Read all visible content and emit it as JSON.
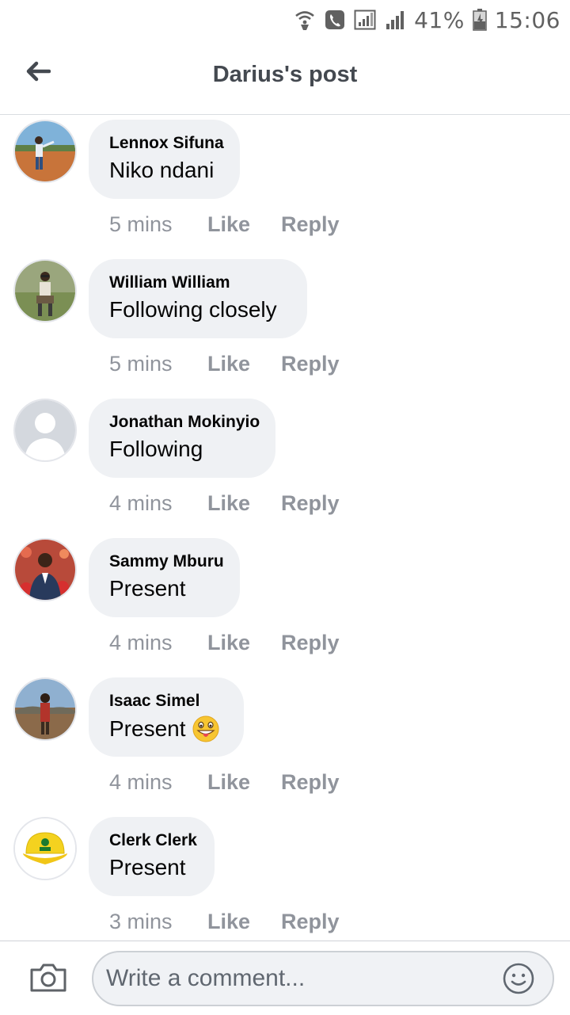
{
  "status_bar": {
    "battery_percent": "41%",
    "time": "15:06",
    "icons": [
      "wifi-calling-icon",
      "phone-icon",
      "signal-icon",
      "signal-icon",
      "battery-icon"
    ]
  },
  "header": {
    "title": "Darius's post",
    "back_icon": "arrow-left-icon"
  },
  "comments": [
    {
      "author": "Lennox Sifuna",
      "text": "Niko ndani",
      "time": "5 mins",
      "like": "Like",
      "reply": "Reply"
    },
    {
      "author": "William William",
      "text": "Following closely",
      "time": "5 mins",
      "like": "Like",
      "reply": "Reply"
    },
    {
      "author": "Jonathan Mokinyio",
      "text": "Following",
      "time": "4 mins",
      "like": "Like",
      "reply": "Reply"
    },
    {
      "author": "Sammy Mburu",
      "text": "Present",
      "time": "4 mins",
      "like": "Like",
      "reply": "Reply"
    },
    {
      "author": "Isaac Simel",
      "text": "Present",
      "emoji": "grinning-tongue-emoji",
      "time": "4 mins",
      "like": "Like",
      "reply": "Reply"
    },
    {
      "author": "Clerk Clerk",
      "text": "Present",
      "time": "3 mins",
      "like": "Like",
      "reply": "Reply"
    }
  ],
  "composer": {
    "placeholder": "Write a comment...",
    "camera_icon": "camera-icon",
    "emoji_icon": "smiley-icon"
  },
  "colors": {
    "bubble": "#eff1f4",
    "meta_text": "#90949c",
    "title_text": "#444950"
  }
}
